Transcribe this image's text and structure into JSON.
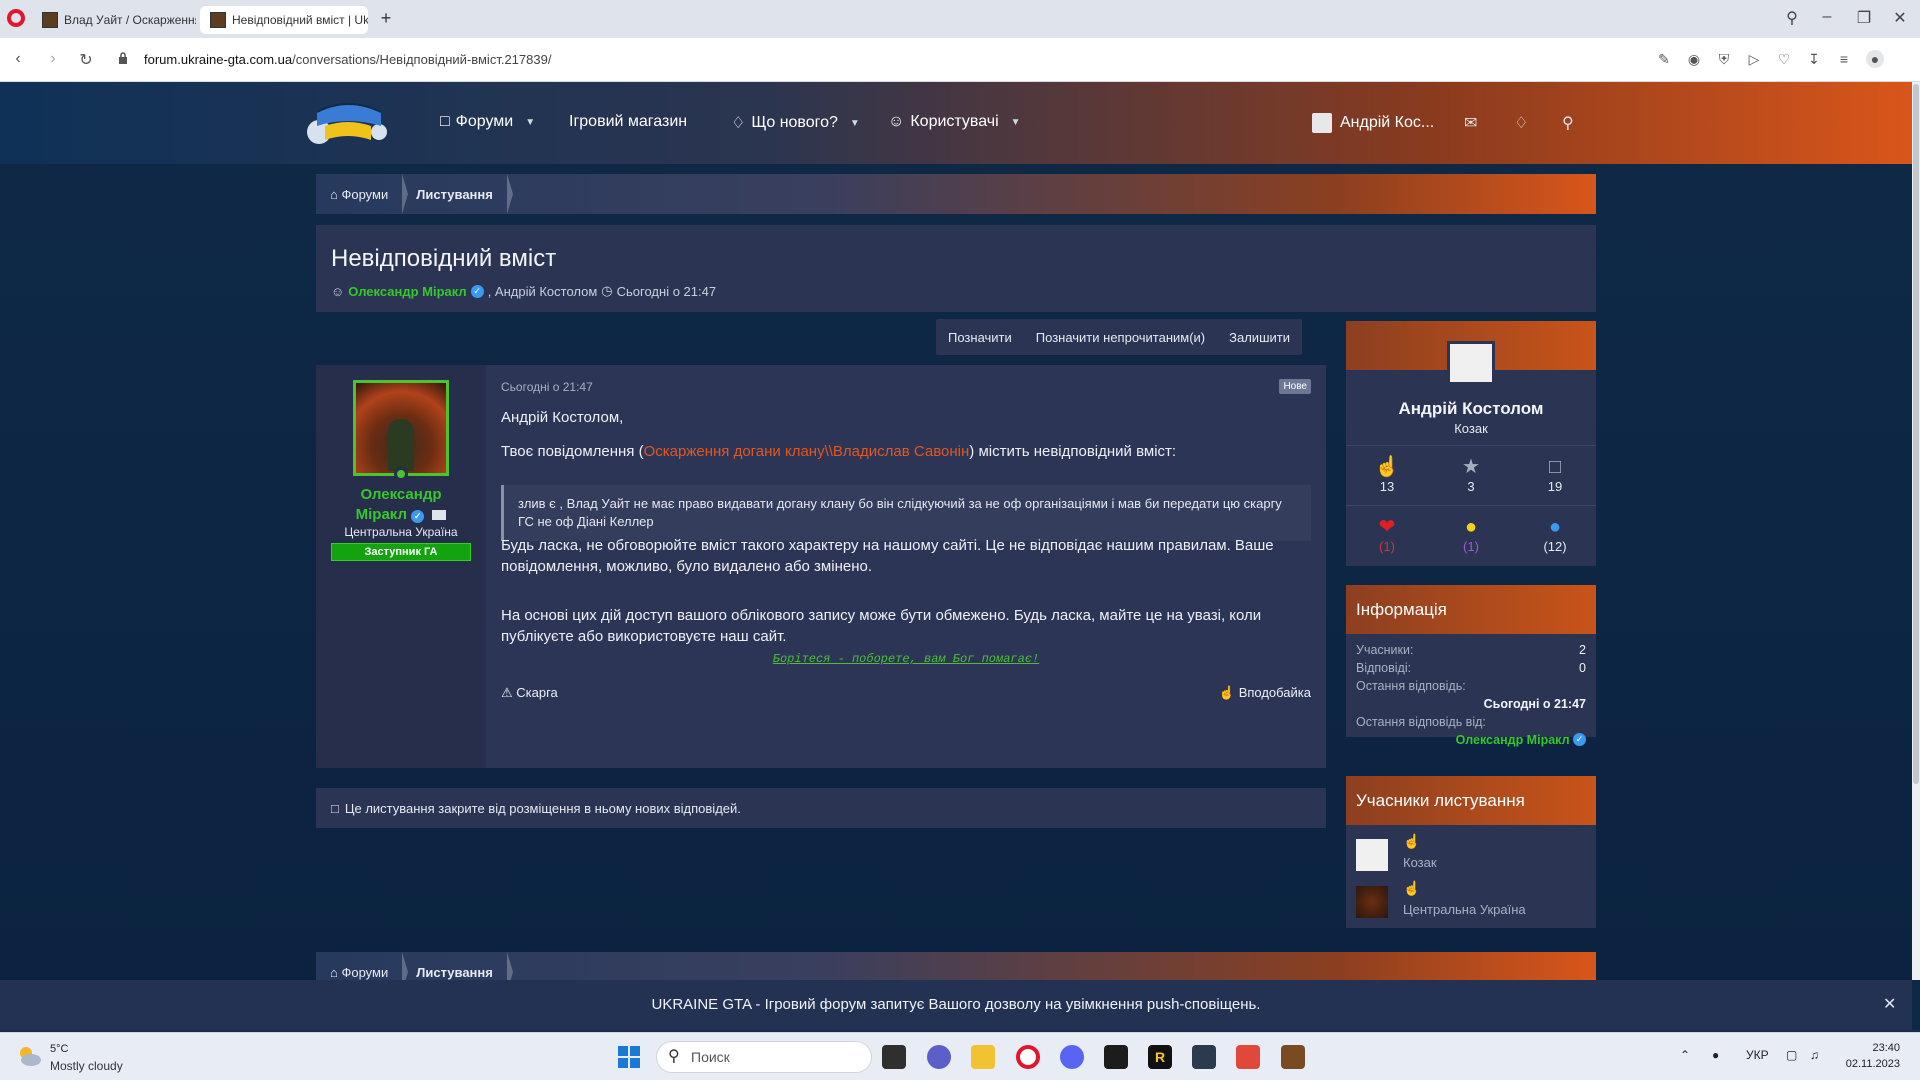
{
  "browser": {
    "tabs": [
      {
        "label": "Влад Уайт / Оскарження"
      },
      {
        "label": "Невідповідний вміст | Uk"
      }
    ],
    "url_domain": "forum.ukraine-gta.com.ua",
    "url_path": "/conversations/Невідповідний-вміст.217839/"
  },
  "header": {
    "nav": {
      "forums": "Форуми",
      "store": "Ігровий магазин",
      "whats_new": "Що нового?",
      "members": "Користувачі"
    },
    "user": "Андрій Кос..."
  },
  "breadcrumb": {
    "home": "Форуми",
    "current": "Листування"
  },
  "conversation": {
    "title": "Невідповідний вміст",
    "starter": "Олександр Міракл",
    "participant": ", Андрій Костолом",
    "time": "Сьогодні о 21:47"
  },
  "actions": {
    "mark": "Позначити",
    "mark_unread": "Позначити непрочитаним(и)",
    "leave": "Залишити"
  },
  "message": {
    "author_line1": "Олександр",
    "author_line2": "Міракл",
    "region": "Центральна Україна",
    "role": "Заступник ГА",
    "date": "Сьогодні о 21:47",
    "badge": "Нове",
    "greeting": "Андрій Костолом,",
    "p1_before": "Твоє повідомлення (",
    "p1_link": "Оскарження догани клану\\\\Владислав Савонін",
    "p1_after": ") містить невідповідний вміст:",
    "quote": "злив є , Влад Уайт не має право видавати догану клану бо він слідкуючий за не оф організаціями і мав би передати цю скаргу ГС не оф Діані Келлер",
    "p2": "Будь ласка, не обговорюйте вміст такого характеру на нашому сайті. Це не відповідає нашим правилам. Ваше повідомлення, можливо, було видалено або змінено.",
    "p3": "На основі цих дій доступ вашого облікового запису може бути обмежено. Будь ласка, майте це на увазі, коли публікуєте або використовуєте наш сайт.",
    "signature": "Борiтеся - поборете, вам Бог помагає!",
    "report": "Скарга",
    "like": "Вподобайка"
  },
  "locked_notice": "Це листування закрите від розміщення в ньому нових відповідей.",
  "profile_card": {
    "name": "Андрій Костолом",
    "rank": "Козак",
    "stats": [
      "13",
      "3",
      "19"
    ],
    "reactions": [
      "(1)",
      "(1)",
      "(12)"
    ]
  },
  "info": {
    "title": "Інформація",
    "participants_label": "Учасники:",
    "participants_value": "2",
    "replies_label": "Відповіді:",
    "replies_value": "0",
    "last_reply_label": "Остання відповідь:",
    "last_reply_value": "Сьогодні о 21:47",
    "last_reply_by_label": "Остання відповідь від:",
    "last_reply_by_value": "Олександр Міракл"
  },
  "participants": {
    "title": "Учасники листування",
    "items": [
      {
        "label": "Козак"
      },
      {
        "label": "Центральна Україна"
      }
    ]
  },
  "push_notice": "UKRAINE GTA - Ігровий форум запитує Вашого дозволу на увімкнення push-сповіщень.",
  "taskbar": {
    "temp": "5°C",
    "condition": "Mostly cloudy",
    "search": "Поиск",
    "lang": "УКР",
    "time": "23:40",
    "date": "02.11.2023"
  },
  "colors": {
    "accent_orange": "#d9561a",
    "page_bg": "#0e2947",
    "green_user": "#36c82a"
  }
}
